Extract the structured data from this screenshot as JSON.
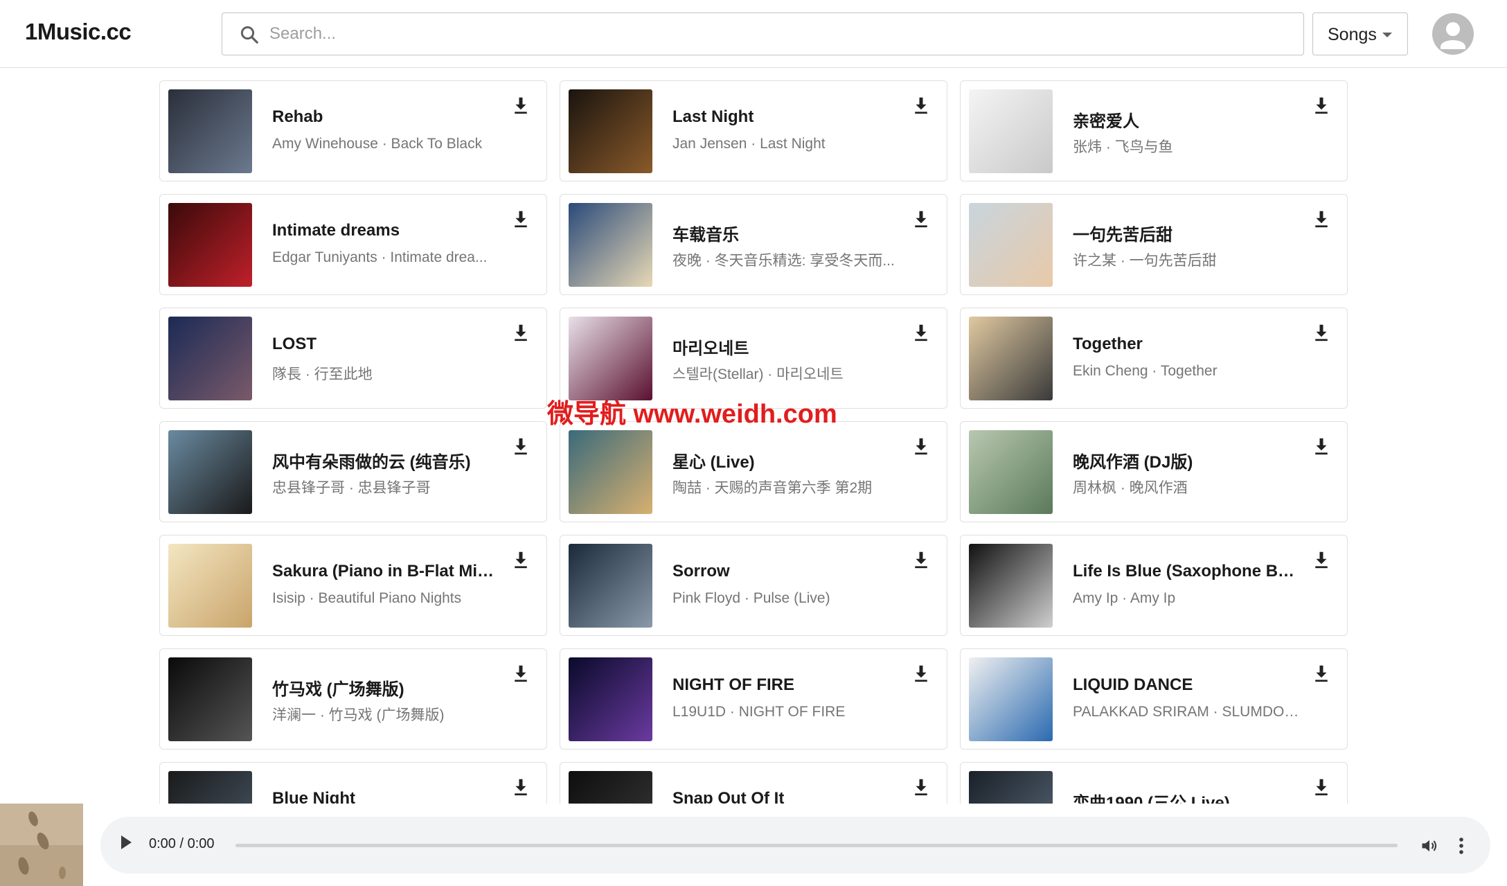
{
  "header": {
    "logo": "1Music.cc",
    "search_placeholder": "Search...",
    "type_selected": "Songs"
  },
  "watermark": "微导航 www.weidh.com",
  "songs": [
    {
      "title": "Rehab",
      "subtitle": "Amy Winehouse · Back To Black"
    },
    {
      "title": "Last Night",
      "subtitle": "Jan Jensen · Last Night"
    },
    {
      "title": "亲密爱人",
      "subtitle": "张炜 · 飞鸟与鱼"
    },
    {
      "title": "Intimate dreams",
      "subtitle": "Edgar Tuniyants · Intimate drea..."
    },
    {
      "title": "车载音乐",
      "subtitle": "夜晚 · 冬天音乐精选: 享受冬天而..."
    },
    {
      "title": "一句先苦后甜",
      "subtitle": "许之某 · 一句先苦后甜"
    },
    {
      "title": "LOST",
      "subtitle": "隊長 · 行至此地"
    },
    {
      "title": "마리오네트",
      "subtitle": "스텔라(Stellar) · 마리오네트"
    },
    {
      "title": "Together",
      "subtitle": "Ekin Cheng · Together"
    },
    {
      "title": "风中有朵雨做的云 (纯音乐)",
      "subtitle": "忠县锋子哥 · 忠县锋子哥"
    },
    {
      "title": "星心 (Live)",
      "subtitle": "陶喆 · 天赐的声音第六季 第2期"
    },
    {
      "title": "晚风作酒 (DJ版)",
      "subtitle": "周林枫 · 晚风作酒"
    },
    {
      "title": "Sakura (Piano in B-Flat Min...",
      "subtitle": "Isisip · Beautiful Piano Nights"
    },
    {
      "title": "Sorrow",
      "subtitle": "Pink Floyd · Pulse (Live)"
    },
    {
      "title": "Life Is Blue (Saxophone Ball...",
      "subtitle": "Amy Ip · Amy Ip"
    },
    {
      "title": "竹马戏 (广场舞版)",
      "subtitle": "洋澜一 · 竹马戏 (广场舞版)"
    },
    {
      "title": "NIGHT OF FIRE",
      "subtitle": "L19U1D · NIGHT OF FIRE"
    },
    {
      "title": "LIQUID DANCE",
      "subtitle": "PALAKKAD SRIRAM · SLUMDOG..."
    },
    {
      "title": "Blue Night",
      "subtitle": ""
    },
    {
      "title": "Snap Out Of It",
      "subtitle": ""
    },
    {
      "title": "恋曲1990 (三公 Live)",
      "subtitle": ""
    }
  ],
  "cover_colors": [
    [
      "#2b2f3a",
      "#6b7a8f"
    ],
    [
      "#1a140f",
      "#8a5a2a"
    ],
    [
      "#f4f4f4",
      "#c9c9c9"
    ],
    [
      "#3a0a0a",
      "#c0202a"
    ],
    [
      "#2a4a7a",
      "#e8d9b5"
    ],
    [
      "#c9d5de",
      "#e8c9a8"
    ],
    [
      "#1b2a55",
      "#7a5a6a"
    ],
    [
      "#e8e0e8",
      "#5a1030"
    ],
    [
      "#e0c9a0",
      "#3a3a3a"
    ],
    [
      "#6a8aa0",
      "#1a1a1a"
    ],
    [
      "#3a6a7a",
      "#d8b070"
    ],
    [
      "#b8c8b0",
      "#5a7a5a"
    ],
    [
      "#f3e6c2",
      "#c9a46a"
    ],
    [
      "#1a2a3a",
      "#8a9aaa"
    ],
    [
      "#111111",
      "#cfcfcf"
    ],
    [
      "#0a0a0a",
      "#555555"
    ],
    [
      "#0a0a2a",
      "#6a3aa0"
    ],
    [
      "#f0f0f0",
      "#2a6ab0"
    ],
    [
      "#1a1a1a",
      "#4a5a6a"
    ],
    [
      "#0e0e0e",
      "#3a3a3a"
    ],
    [
      "#1a2028",
      "#5a6a7a"
    ]
  ],
  "player": {
    "time": "0:00 / 0:00"
  }
}
